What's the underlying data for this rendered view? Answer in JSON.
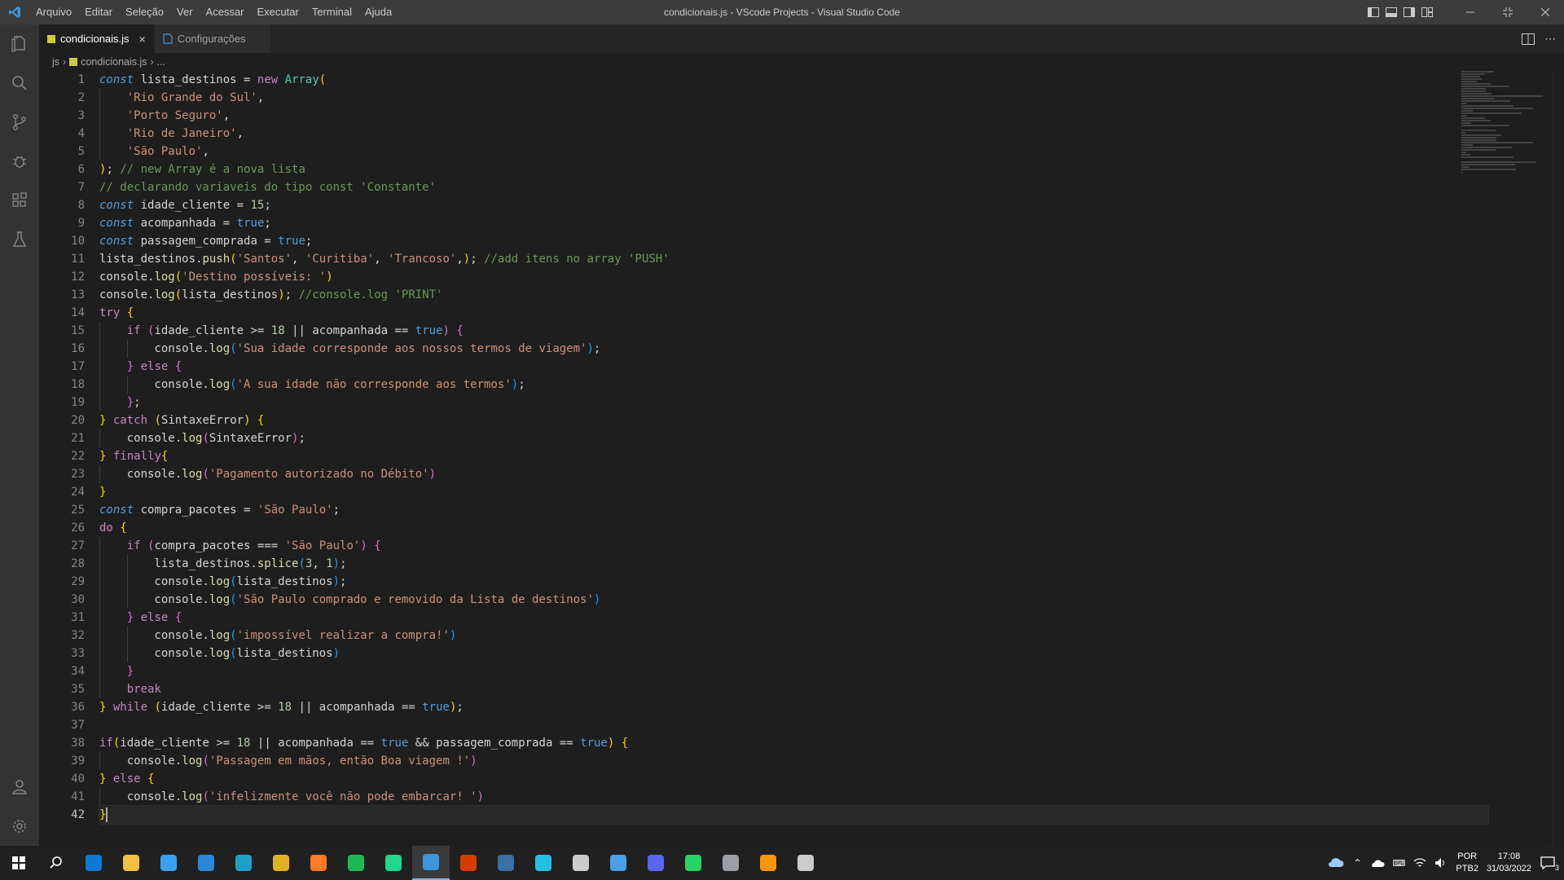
{
  "window_title": "condicionais.js - VScode Projects - Visual Studio Code",
  "menu": [
    "Arquivo",
    "Editar",
    "Seleção",
    "Ver",
    "Acessar",
    "Executar",
    "Terminal",
    "Ajuda"
  ],
  "tabs": [
    {
      "label": "condicionais.js",
      "active": true,
      "icon": "js-file-icon"
    },
    {
      "label": "Configurações",
      "active": false,
      "icon": "settings-file-icon"
    }
  ],
  "breadcrumb": {
    "folder": "js",
    "file": "condicionais.js",
    "more": "..."
  },
  "activity_icons": [
    "explorer-icon",
    "search-icon",
    "source-control-icon",
    "run-debug-icon",
    "extensions-icon",
    "testing-icon"
  ],
  "activity_bottom_icons": [
    "accounts-icon",
    "manage-gear-icon"
  ],
  "editor": {
    "current_line": 42,
    "lines": [
      [
        [
          "kw",
          "const"
        ],
        [
          "pl",
          " lista_destinos "
        ],
        [
          "op",
          "="
        ],
        [
          "pl",
          " "
        ],
        [
          "ctrl",
          "new"
        ],
        [
          "pl",
          " "
        ],
        [
          "cls",
          "Array"
        ],
        [
          "b1",
          "("
        ]
      ],
      [
        [
          "pl",
          "    "
        ],
        [
          "str",
          "'Rio Grande do Sul'"
        ],
        [
          "pl",
          ","
        ]
      ],
      [
        [
          "pl",
          "    "
        ],
        [
          "str",
          "'Porto Seguro'"
        ],
        [
          "pl",
          ","
        ]
      ],
      [
        [
          "pl",
          "    "
        ],
        [
          "str",
          "'Rio de Janeiro'"
        ],
        [
          "pl",
          ","
        ]
      ],
      [
        [
          "pl",
          "    "
        ],
        [
          "str",
          "'São Paulo'"
        ],
        [
          "pl",
          ","
        ]
      ],
      [
        [
          "b1",
          ")"
        ],
        [
          "pl",
          "; "
        ],
        [
          "com",
          "// new Array é a nova lista"
        ]
      ],
      [
        [
          "com",
          "// declarando variaveis do tipo const 'Constante'"
        ]
      ],
      [
        [
          "kw",
          "const"
        ],
        [
          "pl",
          " idade_cliente "
        ],
        [
          "op",
          "="
        ],
        [
          "pl",
          " "
        ],
        [
          "num",
          "15"
        ],
        [
          "pl",
          ";"
        ]
      ],
      [
        [
          "kw",
          "const"
        ],
        [
          "pl",
          " acompanhada "
        ],
        [
          "op",
          "="
        ],
        [
          "pl",
          " "
        ],
        [
          "bool",
          "true"
        ],
        [
          "pl",
          ";"
        ]
      ],
      [
        [
          "kw",
          "const"
        ],
        [
          "pl",
          " passagem_comprada "
        ],
        [
          "op",
          "="
        ],
        [
          "pl",
          " "
        ],
        [
          "bool",
          "true"
        ],
        [
          "pl",
          ";"
        ]
      ],
      [
        [
          "pl",
          "lista_destinos."
        ],
        [
          "fn",
          "push"
        ],
        [
          "b1",
          "("
        ],
        [
          "str",
          "'Santos'"
        ],
        [
          "pl",
          ", "
        ],
        [
          "str",
          "'Curitiba'"
        ],
        [
          "pl",
          ", "
        ],
        [
          "str",
          "'Trancoso'"
        ],
        [
          "pl",
          ","
        ],
        [
          "b1",
          ")"
        ],
        [
          "pl",
          "; "
        ],
        [
          "com",
          "//add itens no array 'PUSH'"
        ]
      ],
      [
        [
          "pl",
          "console."
        ],
        [
          "fn",
          "log"
        ],
        [
          "b1",
          "("
        ],
        [
          "str",
          "'Destino possíveis: '"
        ],
        [
          "b1",
          ")"
        ]
      ],
      [
        [
          "pl",
          "console."
        ],
        [
          "fn",
          "log"
        ],
        [
          "b1",
          "("
        ],
        [
          "pl",
          "lista_destinos"
        ],
        [
          "b1",
          ")"
        ],
        [
          "pl",
          "; "
        ],
        [
          "com",
          "//console.log 'PRINT'"
        ]
      ],
      [
        [
          "ctrl",
          "try"
        ],
        [
          "pl",
          " "
        ],
        [
          "b1",
          "{"
        ]
      ],
      [
        [
          "pl",
          "    "
        ],
        [
          "ctrl",
          "if"
        ],
        [
          "pl",
          " "
        ],
        [
          "b2",
          "("
        ],
        [
          "pl",
          "idade_cliente "
        ],
        [
          "op",
          ">="
        ],
        [
          "pl",
          " "
        ],
        [
          "num",
          "18"
        ],
        [
          "pl",
          " "
        ],
        [
          "op",
          "||"
        ],
        [
          "pl",
          " acompanhada "
        ],
        [
          "op",
          "=="
        ],
        [
          "pl",
          " "
        ],
        [
          "bool",
          "true"
        ],
        [
          "b2",
          ")"
        ],
        [
          "pl",
          " "
        ],
        [
          "b2",
          "{"
        ]
      ],
      [
        [
          "pl",
          "        console."
        ],
        [
          "fn",
          "log"
        ],
        [
          "b3",
          "("
        ],
        [
          "str",
          "'Sua idade corresponde aos nossos termos de viagem'"
        ],
        [
          "b3",
          ")"
        ],
        [
          "pl",
          ";"
        ]
      ],
      [
        [
          "pl",
          "    "
        ],
        [
          "b2",
          "}"
        ],
        [
          "pl",
          " "
        ],
        [
          "ctrl",
          "else"
        ],
        [
          "pl",
          " "
        ],
        [
          "b2",
          "{"
        ]
      ],
      [
        [
          "pl",
          "        console."
        ],
        [
          "fn",
          "log"
        ],
        [
          "b3",
          "("
        ],
        [
          "str",
          "'A sua idade não corresponde aos termos'"
        ],
        [
          "b3",
          ")"
        ],
        [
          "pl",
          ";"
        ]
      ],
      [
        [
          "pl",
          "    "
        ],
        [
          "b2",
          "}"
        ],
        [
          "pl",
          ";"
        ]
      ],
      [
        [
          "b1",
          "}"
        ],
        [
          "pl",
          " "
        ],
        [
          "ctrl",
          "catch"
        ],
        [
          "pl",
          " "
        ],
        [
          "b1",
          "("
        ],
        [
          "pl",
          "SintaxeError"
        ],
        [
          "b1",
          ")"
        ],
        [
          "pl",
          " "
        ],
        [
          "b1",
          "{"
        ]
      ],
      [
        [
          "pl",
          "    console."
        ],
        [
          "fn",
          "log"
        ],
        [
          "b2",
          "("
        ],
        [
          "pl",
          "SintaxeError"
        ],
        [
          "b2",
          ")"
        ],
        [
          "pl",
          ";"
        ]
      ],
      [
        [
          "b1",
          "}"
        ],
        [
          "pl",
          " "
        ],
        [
          "ctrl",
          "finally"
        ],
        [
          "b1",
          "{"
        ]
      ],
      [
        [
          "pl",
          "    console."
        ],
        [
          "fn",
          "log"
        ],
        [
          "b2",
          "("
        ],
        [
          "str",
          "'Pagamento autorizado no Débito'"
        ],
        [
          "b2",
          ")"
        ]
      ],
      [
        [
          "b1",
          "}"
        ]
      ],
      [
        [
          "kw",
          "const"
        ],
        [
          "pl",
          " compra_pacotes "
        ],
        [
          "op",
          "="
        ],
        [
          "pl",
          " "
        ],
        [
          "str",
          "'São Paulo'"
        ],
        [
          "pl",
          ";"
        ]
      ],
      [
        [
          "ctrl",
          "do"
        ],
        [
          "pl",
          " "
        ],
        [
          "b1",
          "{"
        ]
      ],
      [
        [
          "pl",
          "    "
        ],
        [
          "ctrl",
          "if"
        ],
        [
          "pl",
          " "
        ],
        [
          "b2",
          "("
        ],
        [
          "pl",
          "compra_pacotes "
        ],
        [
          "op",
          "==="
        ],
        [
          "pl",
          " "
        ],
        [
          "str",
          "'São Paulo'"
        ],
        [
          "b2",
          ")"
        ],
        [
          "pl",
          " "
        ],
        [
          "b2",
          "{"
        ]
      ],
      [
        [
          "pl",
          "        lista_destinos."
        ],
        [
          "fn",
          "splice"
        ],
        [
          "b3",
          "("
        ],
        [
          "num",
          "3"
        ],
        [
          "pl",
          ", "
        ],
        [
          "num",
          "1"
        ],
        [
          "b3",
          ")"
        ],
        [
          "pl",
          ";"
        ]
      ],
      [
        [
          "pl",
          "        console."
        ],
        [
          "fn",
          "log"
        ],
        [
          "b3",
          "("
        ],
        [
          "pl",
          "lista_destinos"
        ],
        [
          "b3",
          ")"
        ],
        [
          "pl",
          ";"
        ]
      ],
      [
        [
          "pl",
          "        console."
        ],
        [
          "fn",
          "log"
        ],
        [
          "b3",
          "("
        ],
        [
          "str",
          "'São Paulo comprado e removido da Lista de destinos'"
        ],
        [
          "b3",
          ")"
        ]
      ],
      [
        [
          "pl",
          "    "
        ],
        [
          "b2",
          "}"
        ],
        [
          "pl",
          " "
        ],
        [
          "ctrl",
          "else"
        ],
        [
          "pl",
          " "
        ],
        [
          "b2",
          "{"
        ]
      ],
      [
        [
          "pl",
          "        console."
        ],
        [
          "fn",
          "log"
        ],
        [
          "b3",
          "("
        ],
        [
          "str",
          "'impossível realizar a compra!'"
        ],
        [
          "b3",
          ")"
        ]
      ],
      [
        [
          "pl",
          "        console."
        ],
        [
          "fn",
          "log"
        ],
        [
          "b3",
          "("
        ],
        [
          "pl",
          "lista_destinos"
        ],
        [
          "b3",
          ")"
        ]
      ],
      [
        [
          "pl",
          "    "
        ],
        [
          "b2",
          "}"
        ]
      ],
      [
        [
          "pl",
          "    "
        ],
        [
          "ctrl",
          "break"
        ]
      ],
      [
        [
          "b1",
          "}"
        ],
        [
          "pl",
          " "
        ],
        [
          "ctrl",
          "while"
        ],
        [
          "pl",
          " "
        ],
        [
          "b1",
          "("
        ],
        [
          "pl",
          "idade_cliente "
        ],
        [
          "op",
          ">="
        ],
        [
          "pl",
          " "
        ],
        [
          "num",
          "18"
        ],
        [
          "pl",
          " "
        ],
        [
          "op",
          "||"
        ],
        [
          "pl",
          " acompanhada "
        ],
        [
          "op",
          "=="
        ],
        [
          "pl",
          " "
        ],
        [
          "bool",
          "true"
        ],
        [
          "b1",
          ")"
        ],
        [
          "pl",
          ";"
        ]
      ],
      [],
      [
        [
          "ctrl",
          "if"
        ],
        [
          "b1",
          "("
        ],
        [
          "pl",
          "idade_cliente "
        ],
        [
          "op",
          ">="
        ],
        [
          "pl",
          " "
        ],
        [
          "num",
          "18"
        ],
        [
          "pl",
          " "
        ],
        [
          "op",
          "||"
        ],
        [
          "pl",
          " acompanhada "
        ],
        [
          "op",
          "=="
        ],
        [
          "pl",
          " "
        ],
        [
          "bool",
          "true"
        ],
        [
          "pl",
          " "
        ],
        [
          "op",
          "&&"
        ],
        [
          "pl",
          " passagem_comprada "
        ],
        [
          "op",
          "=="
        ],
        [
          "pl",
          " "
        ],
        [
          "bool",
          "true"
        ],
        [
          "b1",
          ")"
        ],
        [
          "pl",
          " "
        ],
        [
          "b1",
          "{"
        ]
      ],
      [
        [
          "pl",
          "    console."
        ],
        [
          "fn",
          "log"
        ],
        [
          "b2",
          "("
        ],
        [
          "str",
          "'Passagem em mãos, então Boa viagem !'"
        ],
        [
          "b2",
          ")"
        ]
      ],
      [
        [
          "b1",
          "}"
        ],
        [
          "pl",
          " "
        ],
        [
          "ctrl",
          "else"
        ],
        [
          "pl",
          " "
        ],
        [
          "b1",
          "{"
        ]
      ],
      [
        [
          "pl",
          "    console."
        ],
        [
          "fn",
          "log"
        ],
        [
          "b2",
          "("
        ],
        [
          "str",
          "'infelizmente você não pode embarcar! '"
        ],
        [
          "b2",
          ")"
        ]
      ],
      [
        [
          "b1",
          "}"
        ]
      ]
    ]
  },
  "taskbar": {
    "apps": [
      "windows-start-icon",
      "search-icon",
      "mail-icon",
      "file-explorer-icon",
      "store-icon",
      "calendar-app-icon",
      "edge-icon",
      "chrome-icon",
      "firefox-icon",
      "spotify-icon",
      "pycharm-icon",
      "vscode-icon",
      "office-icon",
      "mysql-workbench-icon",
      "thunder-app-icon",
      "terminal-icon",
      "package-icon",
      "discord-icon",
      "whatsapp-icon",
      "kali-icon",
      "sublime-icon",
      "obs-icon"
    ],
    "lang_top": "POR",
    "lang_bottom": "PTB2",
    "time": "17:08",
    "date": "31/03/2022",
    "notification_count": "3"
  },
  "colors": {
    "accent": "#007acc",
    "title_bar": "#3c3c3c",
    "editor_bg": "#1e1e1e"
  }
}
